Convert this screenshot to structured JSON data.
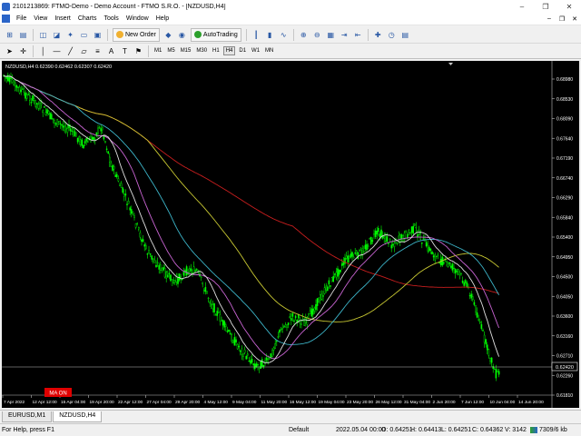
{
  "window": {
    "title": "2101213869: FTMO-Demo - Demo Account - FTMO S.R.O. - [NZDUSD,H4]",
    "controls": [
      "–",
      "❐",
      "✕"
    ]
  },
  "menu": {
    "items": [
      "File",
      "View",
      "Insert",
      "Charts",
      "Tools",
      "Window",
      "Help"
    ],
    "right_controls": [
      "–",
      "❐",
      "✕"
    ]
  },
  "toolbar": {
    "new_order": "New Order",
    "autotrading": "AutoTrading",
    "timeframes": [
      "M1",
      "M5",
      "M15",
      "M30",
      "H1",
      "H4",
      "D1",
      "W1",
      "MN"
    ],
    "active_timeframe": "H4"
  },
  "chart": {
    "header": "NZDUSD,H4  0.62390 0.62462 0.62307 0.62420",
    "ma_label": "MA ON",
    "current_price": "0.62420",
    "price_ticks": [
      "0.68980",
      "0.68530",
      "0.68090",
      "0.67640",
      "0.67190",
      "0.66740",
      "0.66290",
      "0.65840",
      "0.65400",
      "0.64950",
      "0.64500",
      "0.64050",
      "0.63600",
      "0.63160",
      "0.62710",
      "0.62260",
      "0.61810"
    ],
    "time_ticks": [
      "7 Apr 2022",
      "12 Apr 12:00",
      "15 Apr 04:00",
      "19 Apr 20:00",
      "22 Apr 12:00",
      "27 Apr 04:00",
      "29 Apr 20:00",
      "4 May 12:00",
      "9 May 04:00",
      "11 May 20:00",
      "16 May 12:00",
      "19 May 04:00",
      "23 May 20:00",
      "26 May 12:00",
      "31 May 04:00",
      "2 Jun 20:00",
      "7 Jun 12:00",
      "10 Jun 04:00",
      "14 Jun 20:00"
    ],
    "colors": {
      "background": "#000000",
      "candles": "#00ff00",
      "ma_red": "#c81e1e",
      "ma_yellow": "#c8c832",
      "ma_cyan": "#3cb4c8",
      "ma_magenta": "#c864d2",
      "ma_white": "#e0e0e0"
    }
  },
  "tabs": [
    "EURUSD,M1",
    "NZDUSD,H4"
  ],
  "active_tab": "NZDUSD,H4",
  "status": {
    "help": "For Help, press F1",
    "profile": "Default",
    "datetime": "2022.05.04 00:00",
    "open": "O: 0.64251",
    "high": "H: 0.64413",
    "low": "L: 0.64251",
    "close": "C: 0.64362",
    "volume": "V: 3142",
    "traffic": "7309/6 kb"
  }
}
